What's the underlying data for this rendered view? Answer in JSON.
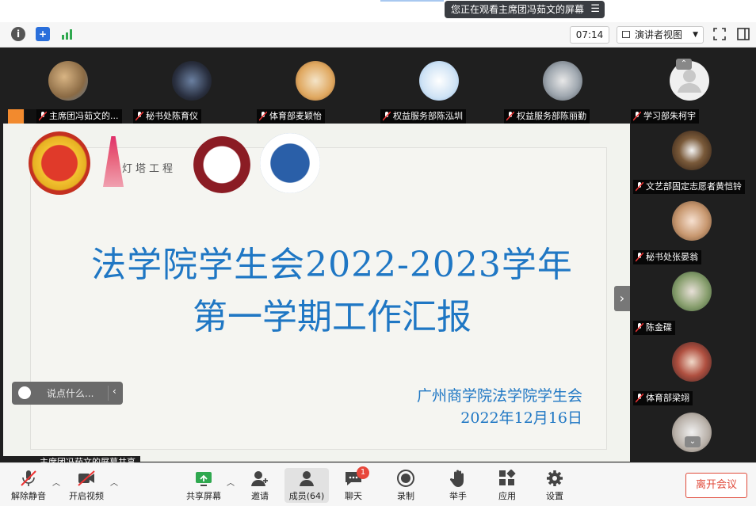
{
  "banner": {
    "viewing_text": "您正在观看主席团冯茹文的屏幕"
  },
  "toolbar": {
    "timer": "07:14",
    "view_mode": "演讲者视图"
  },
  "participants_top": [
    {
      "name": "主席团冯茹文的..."
    },
    {
      "name": "秘书处陈育仪"
    },
    {
      "name": "体育部麦颖怡"
    },
    {
      "name": "权益服务部陈泓圳"
    },
    {
      "name": "权益服务部陈丽勤"
    },
    {
      "name": "学习部朱柯宇"
    }
  ],
  "participants_right": [
    {
      "name": "文艺部固定志愿者黄恺铃"
    },
    {
      "name": "秘书处张晏翁"
    },
    {
      "name": "陈金碟"
    },
    {
      "name": "体育部梁翊"
    }
  ],
  "slide": {
    "logo_text": "灯塔工程",
    "title_line1": "法学院学生会2022-2023学年",
    "title_line2": "第一学期工作汇报",
    "org": "广州商学院法学院学生会",
    "date": "2022年12月16日"
  },
  "chat": {
    "placeholder": "说点什么..."
  },
  "share_tag": "主席团冯茹文的屏幕共享",
  "bottom": {
    "unmute": "解除静音",
    "start_video": "开启视频",
    "share_screen": "共享屏幕",
    "invite": "邀请",
    "members": "成员(64)",
    "chat": "聊天",
    "chat_badge": "1",
    "record": "录制",
    "raise_hand": "举手",
    "apps": "应用",
    "settings": "设置",
    "leave": "离开会议"
  }
}
